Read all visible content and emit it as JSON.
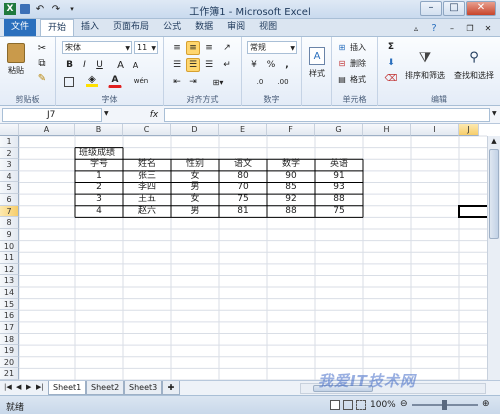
{
  "window": {
    "title": "工作簿1 - Microsoft Excel"
  },
  "quick_access": {
    "undo_label": "↶",
    "redo_label": "↷"
  },
  "tabs": [
    "文件",
    "开始",
    "插入",
    "页面布局",
    "公式",
    "数据",
    "审阅",
    "视图"
  ],
  "ribbon": {
    "clipboard": {
      "paste": "粘贴",
      "label": "剪贴板"
    },
    "font": {
      "name": "宋体",
      "size": "11",
      "bold": "B",
      "italic": "I",
      "underline": "U",
      "grow": "A",
      "shrink": "A",
      "font_color": "A",
      "phonetic": "wén",
      "label": "字体"
    },
    "alignment": {
      "label": "对齐方式"
    },
    "number": {
      "format": "常规",
      "label": "数字",
      "percent": "%",
      "comma": ",",
      "decimal_inc": ".0",
      "decimal_dec": ".00"
    },
    "styles": {
      "label": "样式"
    },
    "cells": {
      "insert": "插入",
      "delete": "删除",
      "format": "格式",
      "label": "单元格"
    },
    "editing": {
      "sum": "Σ",
      "sort_filter": "排序和筛选",
      "find_select": "查找和选择",
      "label": "编辑"
    }
  },
  "formula_bar": {
    "name_box": "J7",
    "fx": "fx",
    "content": ""
  },
  "columns": [
    "A",
    "B",
    "C",
    "D",
    "E",
    "F",
    "G",
    "H",
    "I",
    "J"
  ],
  "rows": [
    "1",
    "2",
    "3",
    "4",
    "5",
    "6",
    "7",
    "8",
    "9",
    "10",
    "11",
    "12",
    "13",
    "14",
    "15",
    "16",
    "17",
    "18",
    "19",
    "20",
    "21"
  ],
  "table": {
    "title": "班级成绩",
    "headers": [
      "学号",
      "姓名",
      "性别",
      "语文",
      "数学",
      "英语"
    ],
    "rows": [
      [
        "1",
        "张三",
        "女",
        "80",
        "90",
        "91"
      ],
      [
        "2",
        "李四",
        "男",
        "70",
        "85",
        "93"
      ],
      [
        "3",
        "王五",
        "女",
        "75",
        "92",
        "88"
      ],
      [
        "4",
        "赵六",
        "男",
        "81",
        "88",
        "75"
      ]
    ]
  },
  "sheets": [
    "Sheet1",
    "Sheet2",
    "Sheet3"
  ],
  "status": {
    "ready": "就绪",
    "zoom": "100%"
  },
  "watermark": "我爱IT技术网"
}
